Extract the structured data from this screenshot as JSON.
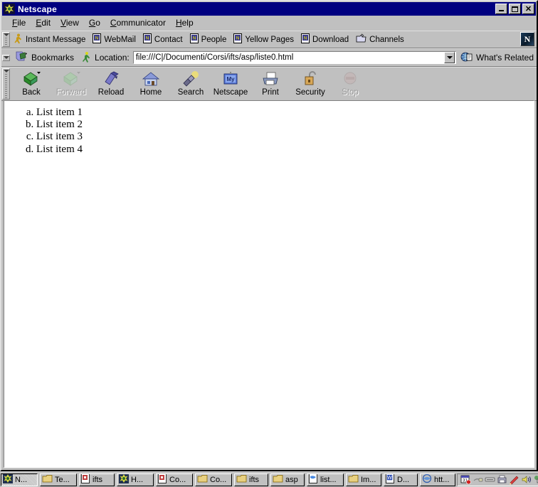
{
  "window": {
    "title": "Netscape",
    "icon": "netscape-n-icon",
    "controls": [
      {
        "name": "minimize-button",
        "glyph": "_"
      },
      {
        "name": "maximize-button",
        "glyph": "□"
      },
      {
        "name": "close-button",
        "glyph": "✕"
      }
    ]
  },
  "menubar": {
    "items": [
      {
        "label": "File",
        "accel": "F"
      },
      {
        "label": "Edit",
        "accel": "E"
      },
      {
        "label": "View",
        "accel": "V"
      },
      {
        "label": "Go",
        "accel": "G"
      },
      {
        "label": "Communicator",
        "accel": "C"
      },
      {
        "label": "Help",
        "accel": "H"
      }
    ]
  },
  "personal_toolbar": {
    "items": [
      {
        "label": "Instant Message",
        "icon": "running-man-icon"
      },
      {
        "label": "WebMail",
        "icon": "page-icon"
      },
      {
        "label": "Contact",
        "icon": "page-icon"
      },
      {
        "label": "People",
        "icon": "page-icon"
      },
      {
        "label": "Yellow Pages",
        "icon": "page-icon"
      },
      {
        "label": "Download",
        "icon": "page-icon"
      },
      {
        "label": "Channels",
        "icon": "folder-channel-icon"
      }
    ],
    "logo_label": "N",
    "logo_name": "netscape-logo-button"
  },
  "location_bar": {
    "bookmarks_label": "Bookmarks",
    "bookmarks_icon": "bookmark-icon",
    "location_label": "Location:",
    "location_icon": "location-pin-icon",
    "url": "file:///C|/Documenti/Corsi/ifts/asp/liste0.html",
    "url_placeholder": "Enter a URL",
    "dropdown_icon": "chevron-down-icon",
    "whats_related_label": "What's Related",
    "whats_related_icon": "related-pages-icon"
  },
  "nav_toolbar": {
    "buttons": [
      {
        "label": "Back",
        "icon": "back-arrow-icon",
        "enabled": true
      },
      {
        "label": "Forward",
        "icon": "forward-arrow-icon",
        "enabled": false
      },
      {
        "label": "Reload",
        "icon": "reload-icon",
        "enabled": true
      },
      {
        "label": "Home",
        "icon": "home-icon",
        "enabled": true
      },
      {
        "label": "Search",
        "icon": "search-flashlight-icon",
        "enabled": true
      },
      {
        "label": "Netscape",
        "icon": "my-netscape-icon",
        "enabled": true
      },
      {
        "label": "Print",
        "icon": "printer-icon",
        "enabled": true
      },
      {
        "label": "Security",
        "icon": "padlock-icon",
        "enabled": true
      },
      {
        "label": "Stop",
        "icon": "stop-icon",
        "enabled": false
      }
    ]
  },
  "page_content": {
    "list_type": "lower-alpha",
    "items": [
      "List item 1",
      "List item 2",
      "List item 3",
      "List item 4"
    ]
  },
  "taskbar": {
    "buttons": [
      {
        "label": "N...",
        "icon": "netscape-icon",
        "active": true
      },
      {
        "label": "Te...",
        "icon": "folder-icon",
        "active": false
      },
      {
        "label": "ifts",
        "icon": "document-icon",
        "active": false
      },
      {
        "label": "H...",
        "icon": "netscape-icon",
        "active": false
      },
      {
        "label": "Co...",
        "icon": "document-icon",
        "active": false
      },
      {
        "label": "Co...",
        "icon": "folder-icon",
        "active": false
      },
      {
        "label": "ifts",
        "icon": "folder-icon",
        "active": false
      },
      {
        "label": "asp",
        "icon": "folder-icon",
        "active": false
      },
      {
        "label": "list...",
        "icon": "notepad-icon",
        "active": false
      },
      {
        "label": "Im...",
        "icon": "folder-icon",
        "active": false
      },
      {
        "label": "D...",
        "icon": "word-icon",
        "active": false
      },
      {
        "label": "htt...",
        "icon": "explorer-icon",
        "active": false
      }
    ],
    "tray_icons": [
      "calendar-icon",
      "modem-icon",
      "network-icon",
      "printer-tray-icon",
      "pencil-icon",
      "volume-icon",
      "monitor-icon",
      "clock-icon",
      "shield-icon"
    ]
  },
  "colors": {
    "title_bar": "#000080",
    "face": "#c0c0c0",
    "content_bg": "#ffffff",
    "disabled_text": "#9a9a9a"
  }
}
